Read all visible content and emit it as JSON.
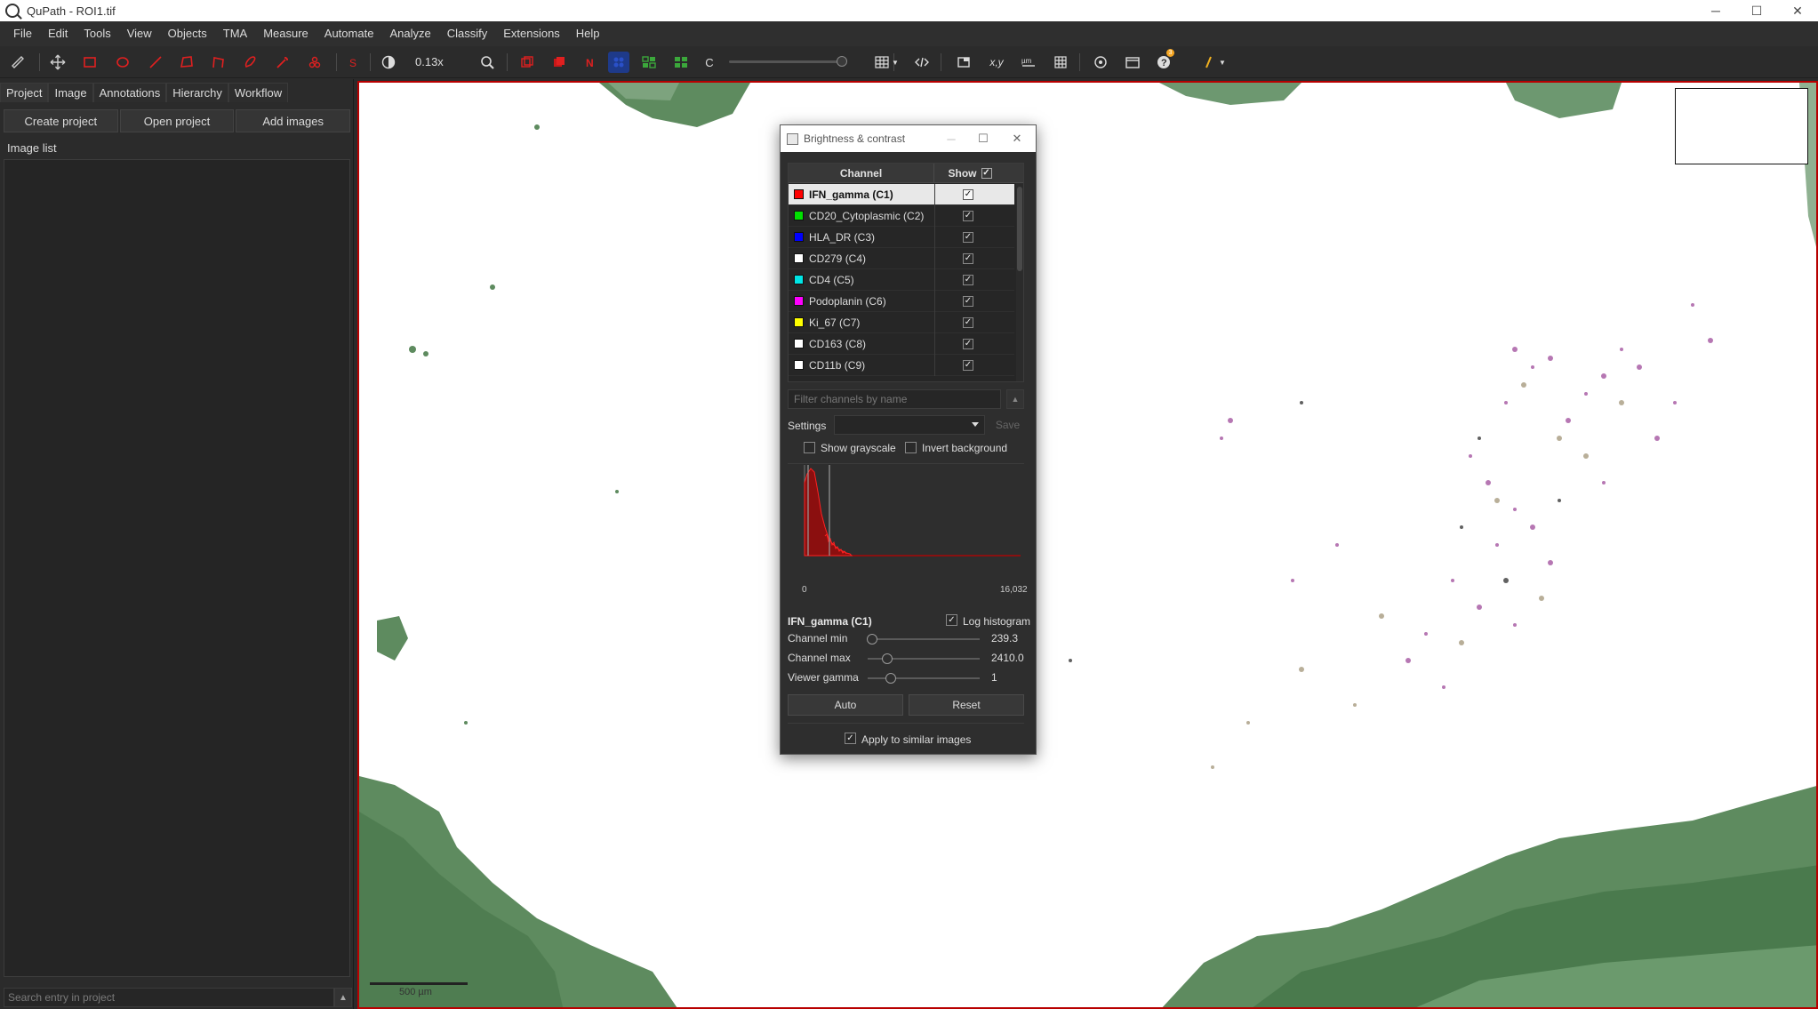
{
  "window": {
    "title": "QuPath - ROI1.tif"
  },
  "menu": [
    "File",
    "Edit",
    "Tools",
    "View",
    "Objects",
    "TMA",
    "Measure",
    "Automate",
    "Analyze",
    "Classify",
    "Extensions",
    "Help"
  ],
  "toolbar": {
    "zoom": "0.13x",
    "channel_letter": "C",
    "coords_label": "x,y",
    "notification_count": "3"
  },
  "left_panel": {
    "tabs": [
      "Project",
      "Image",
      "Annotations",
      "Hierarchy",
      "Workflow"
    ],
    "buttons": {
      "create": "Create project",
      "open": "Open project",
      "add": "Add images"
    },
    "image_list_label": "Image list",
    "search_placeholder": "Search entry in project"
  },
  "viewer": {
    "scalebar_label": "500 µm"
  },
  "dialog": {
    "title": "Brightness & contrast",
    "table_headers": {
      "channel": "Channel",
      "show": "Show"
    },
    "channels": [
      {
        "name": "IFN_gamma (C1)",
        "color": "#ff0000",
        "shown": true,
        "selected": true
      },
      {
        "name": "CD20_Cytoplasmic (C2)",
        "color": "#00e000",
        "shown": true
      },
      {
        "name": "HLA_DR (C3)",
        "color": "#0000ff",
        "shown": true
      },
      {
        "name": "CD279 (C4)",
        "color": "#ffffff",
        "shown": true
      },
      {
        "name": "CD4 (C5)",
        "color": "#00e5e5",
        "shown": true
      },
      {
        "name": "Podoplanin (C6)",
        "color": "#ff00ff",
        "shown": true
      },
      {
        "name": "Ki_67 (C7)",
        "color": "#ffff00",
        "shown": true
      },
      {
        "name": "CD163 (C8)",
        "color": "#ffffff",
        "shown": true
      },
      {
        "name": "CD11b (C9)",
        "color": "#ffffff",
        "shown": true
      }
    ],
    "filter_placeholder": "Filter channels by name",
    "settings_label": "Settings",
    "save_label": "Save",
    "show_grayscale": "Show grayscale",
    "invert_background": "Invert background",
    "histogram": {
      "min_label": "0",
      "max_label": "16,032"
    },
    "selected_channel": "IFN_gamma (C1)",
    "log_histogram": "Log histogram",
    "channel_min_label": "Channel min",
    "channel_min_value": "239.3",
    "channel_max_label": "Channel max",
    "channel_max_value": "2410.0",
    "viewer_gamma_label": "Viewer gamma",
    "viewer_gamma_value": "1",
    "auto_label": "Auto",
    "reset_label": "Reset",
    "apply_similar": "Apply to similar images"
  }
}
